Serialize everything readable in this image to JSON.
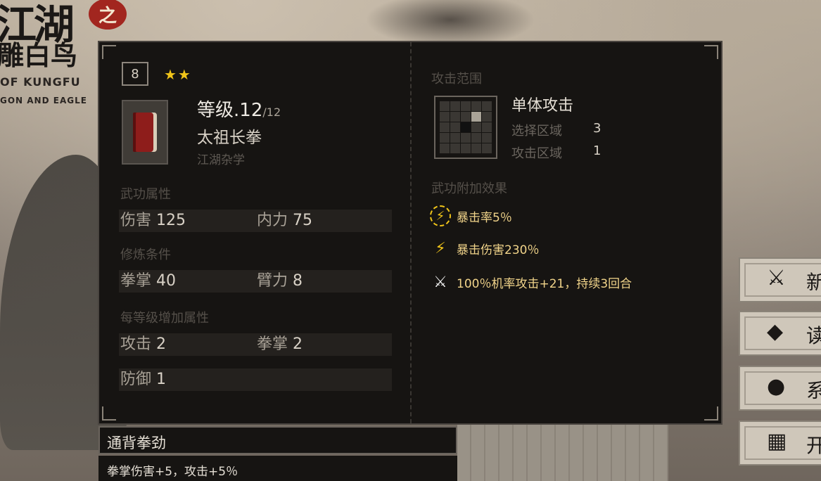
{
  "logo": {
    "title_main": "江湖",
    "seal": "之",
    "title_sub": "雕白鸟",
    "en_line1": "OF KUNGFU",
    "en_line2": "GON AND EAGLE"
  },
  "skill": {
    "badge": "8",
    "stars": "★★",
    "level_label": "等级",
    "level_current": ".12",
    "level_max": "/12",
    "name": "太祖长拳",
    "school": "江湖杂学"
  },
  "sections": {
    "attributes_label": "武功属性",
    "requirements_label": "修炼条件",
    "per_level_label": "每等级增加属性"
  },
  "attributes": [
    {
      "k": "伤害",
      "v": "125"
    },
    {
      "k": "内力",
      "v": "75"
    }
  ],
  "requirements": [
    {
      "k": "拳掌",
      "v": "40"
    },
    {
      "k": "臂力",
      "v": "8"
    }
  ],
  "per_level": [
    {
      "k": "攻击",
      "v": "2"
    },
    {
      "k": "拳掌",
      "v": "2"
    },
    {
      "k": "防御",
      "v": "1"
    }
  ],
  "attack_range": {
    "label": "攻击范围",
    "type": "单体攻击",
    "select_label": "选择区域",
    "select_value": "3",
    "attack_label": "攻击区域",
    "attack_value": "1"
  },
  "effects_label": "武功附加效果",
  "effects": [
    {
      "icon": "lightning-ring-icon",
      "text": "暴击率5％"
    },
    {
      "icon": "lightning-icon",
      "text": "暴击伤害230％"
    },
    {
      "icon": "sword-icon",
      "text": "100％机率攻击+21，持续3回合"
    }
  ],
  "talent": {
    "name": "通背拳劲",
    "desc": "拳掌伤害+5，攻击+5％"
  },
  "side_menu": [
    {
      "icon": "sword-icon",
      "label": "新"
    },
    {
      "icon": "book-icon",
      "label": "读"
    },
    {
      "icon": "rice-ball-icon",
      "label": "系"
    },
    {
      "icon": "scroll-icon",
      "label": "开"
    }
  ],
  "colors": {
    "accent_gold": "#f0c419",
    "panel_bg": "#161412",
    "text_light": "#e5dfd5"
  }
}
